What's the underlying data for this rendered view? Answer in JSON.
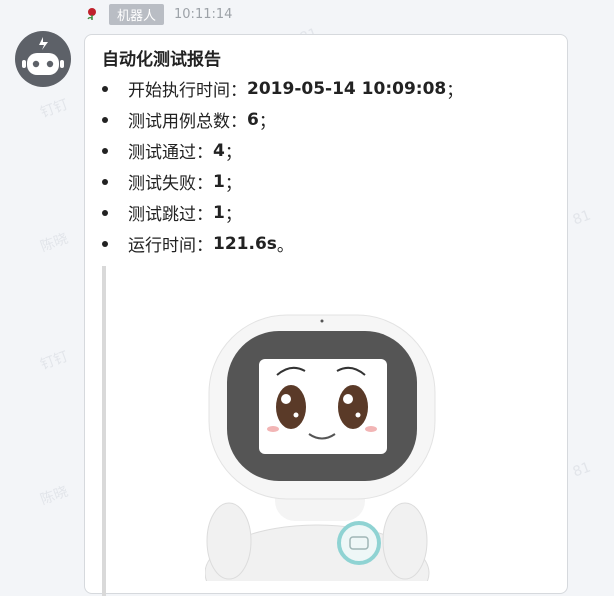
{
  "header": {
    "sender": "机器人",
    "time": "10:11:14"
  },
  "watermark": {
    "text_a": "钉钉",
    "text_b": "陈晓",
    "text_c": "81"
  },
  "message": {
    "title": "自动化测试报告",
    "items": [
      {
        "label": "开始执行时间：",
        "value": "2019-05-14 10:09:08",
        "suffix": "；"
      },
      {
        "label": "测试用例总数：",
        "value": "6",
        "suffix": "；"
      },
      {
        "label": "测试通过：",
        "value": "4",
        "suffix": "；"
      },
      {
        "label": "测试失败：",
        "value": "1",
        "suffix": "；"
      },
      {
        "label": "测试跳过：",
        "value": "1",
        "suffix": "；"
      },
      {
        "label": "运行时间：",
        "value": "121.6s",
        "suffix": " 。"
      }
    ]
  },
  "colors": {
    "avatar_bg": "#5d6168",
    "robot_screen": "#555555",
    "robot_body": "#f4f4f4",
    "robot_accent": "#8fd3d3"
  }
}
